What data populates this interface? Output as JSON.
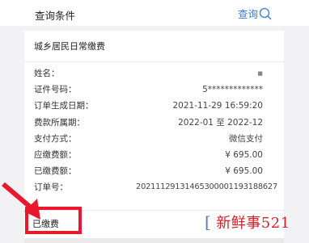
{
  "header": {
    "title": "查询条件",
    "query_label": "查询"
  },
  "card": {
    "title": "城乡居民日常缴费",
    "rows": [
      {
        "label": "姓名：",
        "value": "■"
      },
      {
        "label": "证件号码：",
        "value": "5*************"
      },
      {
        "label": "订单生成日期：",
        "value": "2021-11-29 16:59:20"
      },
      {
        "label": "费款所属期：",
        "value": "2022-01 至 2022-12"
      },
      {
        "label": "支付方式：",
        "value": "微信支付"
      },
      {
        "label": "应缴费额：",
        "value": "¥ 695.00"
      },
      {
        "label": "已缴费额：",
        "value": "¥ 695.00"
      },
      {
        "label": "订单号：",
        "value": "20211129131465300001193188627"
      }
    ],
    "status": "已缴费"
  },
  "watermark": {
    "text": "新鲜事521"
  },
  "colors": {
    "accent": "#3a7bd5",
    "highlight": "#e8192c"
  }
}
